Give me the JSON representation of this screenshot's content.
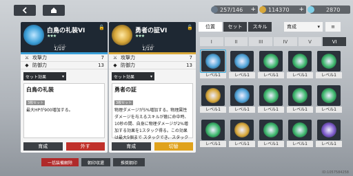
{
  "top": {
    "back_icon": "back-arrow-icon",
    "home_icon": "home-icon",
    "stamina": "257/146",
    "coins": "114370",
    "gems": "2870",
    "plus": "+"
  },
  "cards": [
    {
      "name": "白鳥の礼装VI",
      "level_label": "レベル",
      "level": "1/10",
      "stars": "★★★",
      "stats": [
        {
          "label": "攻撃力",
          "value": "7"
        },
        {
          "label": "防御力",
          "value": "13"
        }
      ],
      "effect_dropdown": "セット効果",
      "set_title": "白鳥の礼装",
      "set_tag": "3枚セット",
      "set_desc": "最大HPが900増加する。",
      "btn_left": "育成",
      "btn_right": "外す",
      "bar_color": "#3a9fd8",
      "right_btn_color": "#c0312b"
    },
    {
      "name": "勇者の証VI",
      "level_label": "レベル",
      "level": "1/10",
      "stars": "★★★",
      "stats": [
        {
          "label": "攻撃力",
          "value": "7"
        },
        {
          "label": "防御力",
          "value": "13"
        }
      ],
      "effect_dropdown": "セット効果",
      "set_title": "勇者の証",
      "set_tag": "3枚セット",
      "set_desc": "物理ダメージが5%増加する。物理属性ダメージを与えるスキルが敵に命中時、10秒の間、自身に物理ダメージが2%増加する効果を1スタック得る。この効果は最大5個まで スタックでき、スタック",
      "btn_left": "育成",
      "btn_right": "切替",
      "bar_color": "#d8a83a",
      "right_btn_color": "#e0a21c"
    }
  ],
  "bottom_buttons": [
    "一括装備解除",
    "朝印収還",
    "推奨朝印"
  ],
  "panel": {
    "tabs": [
      "位置",
      "セット",
      "スキル"
    ],
    "sort_label": "育成",
    "sort_icon": "sort-icon",
    "roman_tabs": [
      "I",
      "II",
      "III",
      "IV",
      "V",
      "VI"
    ],
    "selected_roman": 5,
    "level_label": "レベル1",
    "items": [
      {
        "color": "#4fa3d8",
        "selected": true
      },
      {
        "color": "#4fa3d8",
        "selected": false
      },
      {
        "color": "#3bb56a",
        "selected": false
      },
      {
        "color": "#3bb56a",
        "selected": false
      },
      {
        "color": "#3bb56a",
        "selected": false
      },
      {
        "color": "#d8a83a",
        "selected": false
      },
      {
        "color": "#4fa3d8",
        "selected": false
      },
      {
        "color": "#3bb56a",
        "selected": false
      },
      {
        "color": "#3bb56a",
        "selected": false
      },
      {
        "color": "#3bb56a",
        "selected": false
      },
      {
        "color": "#3bb56a",
        "selected": false
      },
      {
        "color": "#d8a83a",
        "selected": false
      },
      {
        "color": "#3bb56a",
        "selected": false
      },
      {
        "color": "#3bb56a",
        "selected": false
      },
      {
        "color": "#7a58c8",
        "selected": false
      }
    ]
  },
  "uid": "ID:1057584258"
}
